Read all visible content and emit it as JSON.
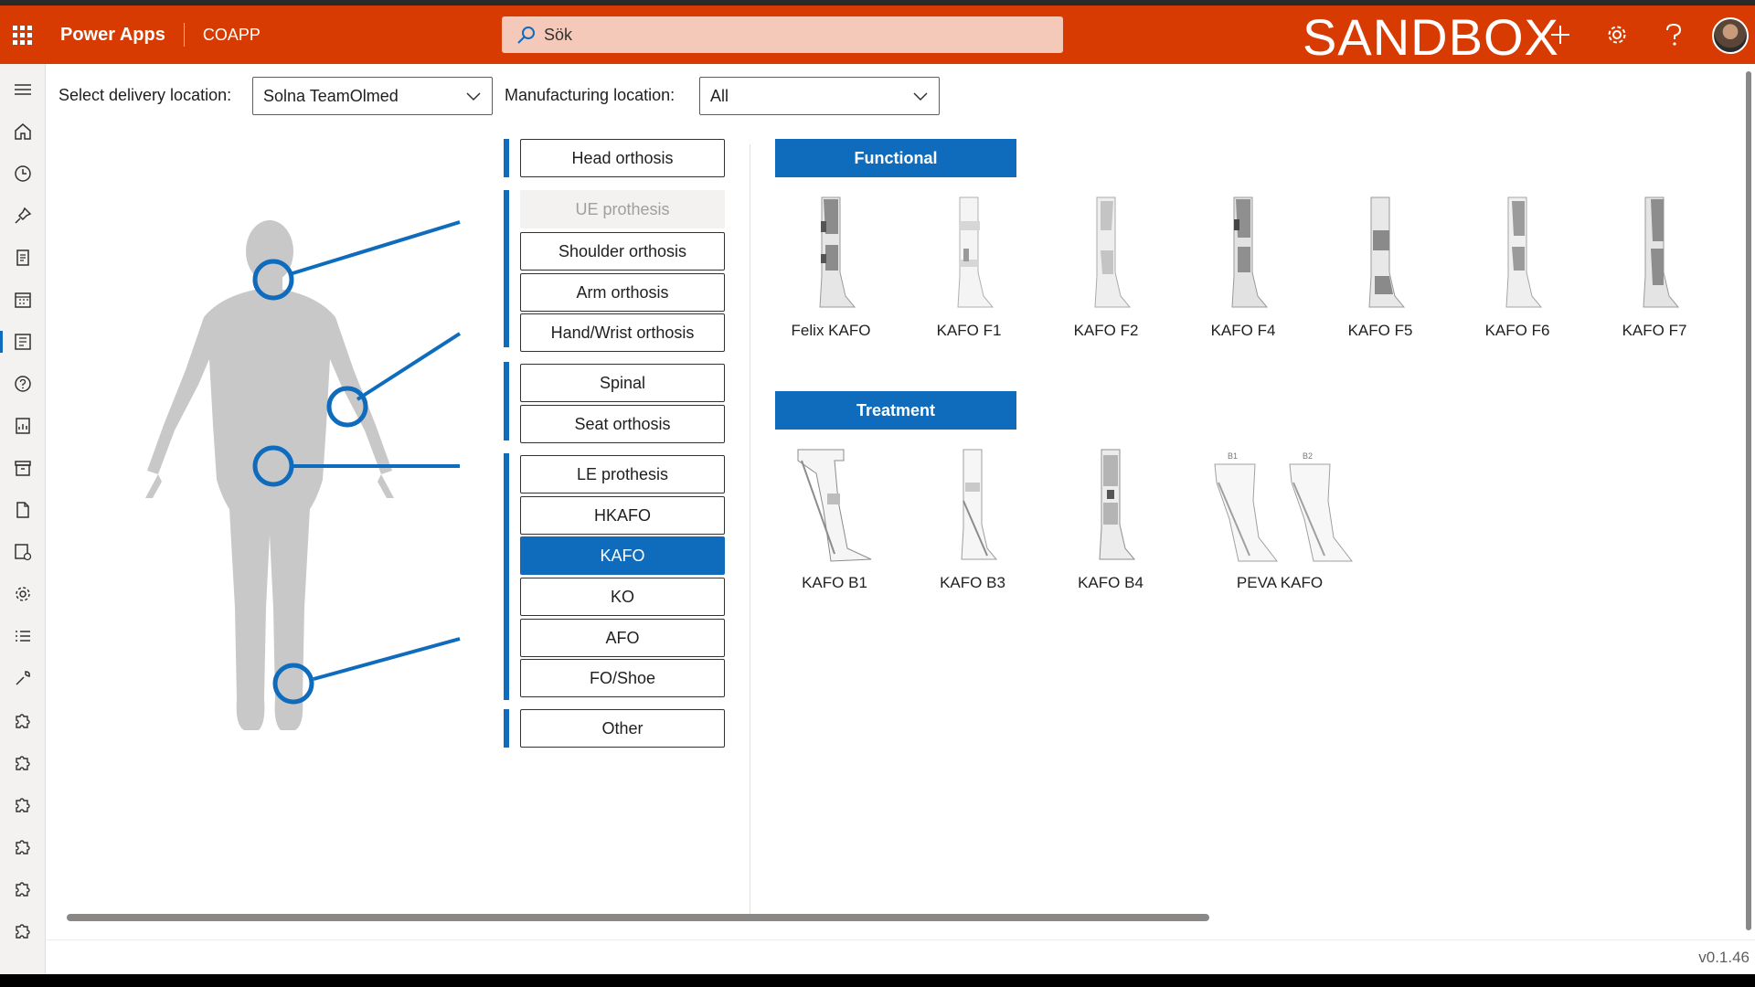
{
  "header": {
    "app_name": "Power Apps",
    "environment": "COAPP",
    "search_placeholder": "Sök",
    "banner": "SANDBOX",
    "brand_color": "#d83b01"
  },
  "filters": {
    "delivery_label": "Select delivery location:",
    "delivery_value": "Solna TeamOlmed",
    "manufacturing_label": "Manufacturing location:",
    "manufacturing_value": "All"
  },
  "categories": {
    "head": "Head orthosis",
    "ue_prosthesis": "UE prothesis",
    "shoulder": "Shoulder orthosis",
    "arm": "Arm orthosis",
    "hand_wrist": "Hand/Wrist orthosis",
    "spinal": "Spinal",
    "seat": "Seat orthosis",
    "le_prosthesis": "LE prothesis",
    "hkafo": "HKAFO",
    "kafo": "KAFO",
    "ko": "KO",
    "afo": "AFO",
    "fo_shoe": "FO/Shoe",
    "other": "Other"
  },
  "selected_category": "KAFO",
  "sections": {
    "functional": {
      "title": "Functional",
      "products": [
        "Felix KAFO",
        "KAFO F1",
        "KAFO F2",
        "KAFO F4",
        "KAFO F5",
        "KAFO F6",
        "KAFO F7"
      ]
    },
    "treatment": {
      "title": "Treatment",
      "products": [
        "KAFO B1",
        "KAFO B3",
        "KAFO B4",
        "PEVA KAFO"
      ],
      "peva_marks": [
        "B1",
        "B2"
      ]
    }
  },
  "nav_icons": [
    "menu-icon",
    "home-icon",
    "recent-icon",
    "pin-icon",
    "document-icon",
    "calendar-icon",
    "order-icon",
    "help-icon",
    "report-icon",
    "archive-icon",
    "file-icon",
    "settings-list-icon",
    "gear-icon",
    "list-icon",
    "tools-icon",
    "puzzle-icon",
    "puzzle-icon",
    "puzzle-icon",
    "puzzle-icon",
    "puzzle-icon",
    "puzzle-icon"
  ],
  "version": "v0.1.46",
  "accent_color": "#0f6cbd"
}
